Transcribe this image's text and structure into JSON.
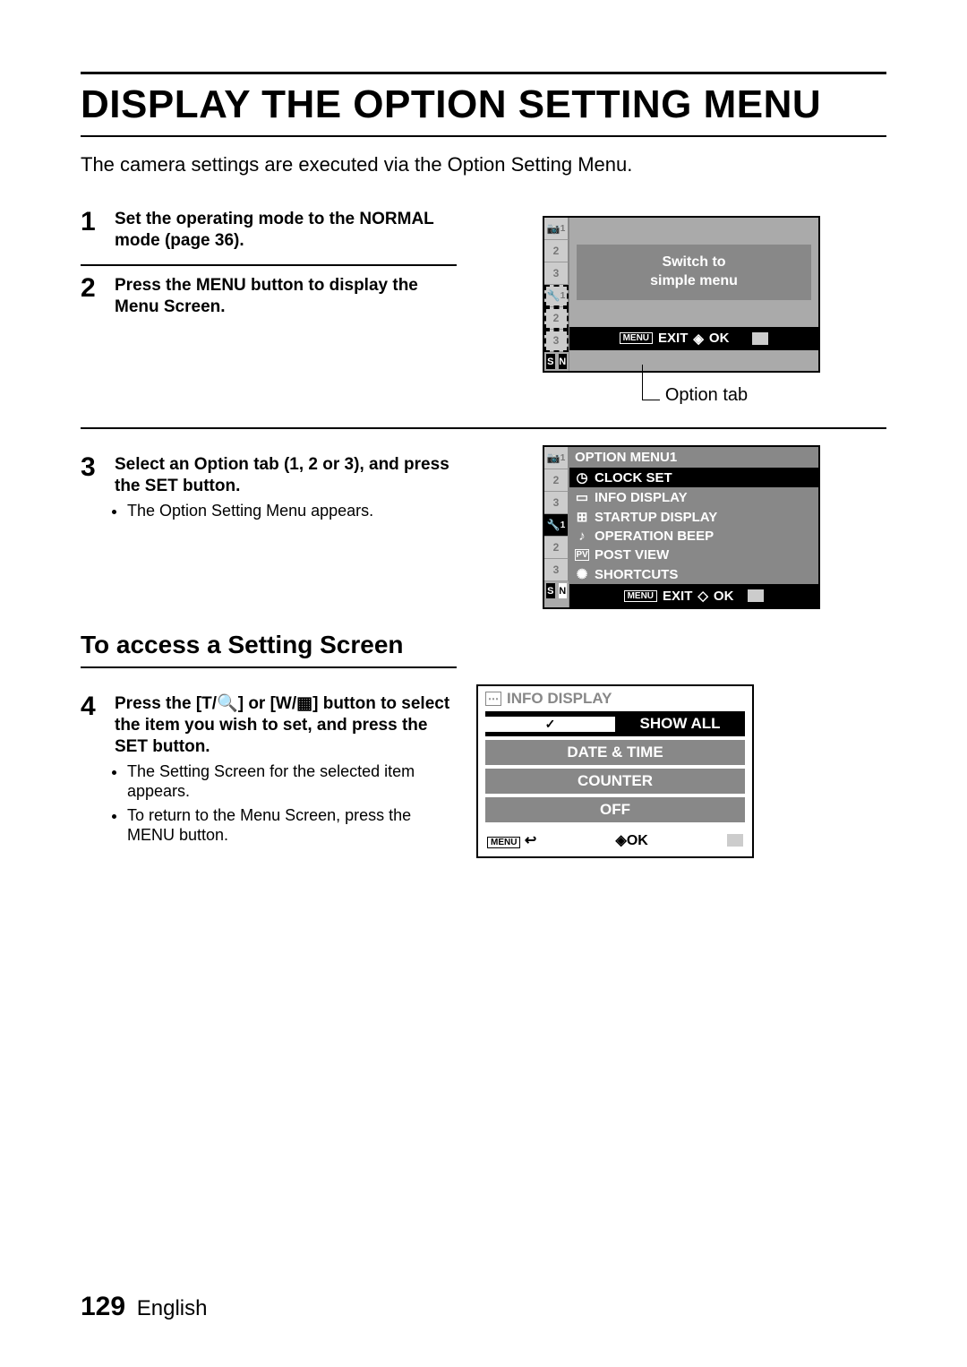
{
  "title": "DISPLAY THE OPTION SETTING MENU",
  "intro": "The camera settings are executed via the Option Setting Menu.",
  "steps": {
    "s1": {
      "num": "1",
      "head": "Set the operating mode to the NORMAL mode (page 36)."
    },
    "s2": {
      "num": "2",
      "head": "Press the MENU button to display the Menu Screen."
    },
    "s3": {
      "num": "3",
      "head": "Select an Option tab (1, 2 or 3), and press the SET button.",
      "bullet1": "The Option Setting Menu appears."
    },
    "s4": {
      "num": "4",
      "head_part1": "Press the [T/",
      "head_part2": "] or [W/",
      "head_part3": "] button to select the item you wish to set, and press the SET button.",
      "bullet1": "The Setting Screen for the selected item appears.",
      "bullet2": "To return to the Menu Screen, press the MENU button."
    }
  },
  "subheading": "To access a Setting Screen",
  "screen1": {
    "msg_line1": "Switch to",
    "msg_line2": "simple menu",
    "menu_tag": "MENU",
    "exit": "EXIT",
    "ok": "OK",
    "tabs": [
      "1",
      "2",
      "3",
      "1",
      "2",
      "3"
    ],
    "label_below": "Option tab"
  },
  "screen2": {
    "title": "OPTION MENU1",
    "items": [
      {
        "icon": "clock-icon",
        "label": "CLOCK SET"
      },
      {
        "icon": "display-icon",
        "label": "INFO DISPLAY"
      },
      {
        "icon": "startup-icon",
        "label": "STARTUP DISPLAY"
      },
      {
        "icon": "beep-icon",
        "label": "OPERATION BEEP"
      },
      {
        "icon": "postview-icon",
        "label": "POST VIEW"
      },
      {
        "icon": "shortcut-icon",
        "label": "SHORTCUTS"
      }
    ],
    "menu_tag": "MENU",
    "exit": "EXIT",
    "ok": "OK",
    "tabs": [
      "1",
      "2",
      "3",
      "1",
      "2",
      "3"
    ]
  },
  "screen3": {
    "header": "INFO DISPLAY",
    "items": [
      "SHOW ALL",
      "DATE & TIME",
      "COUNTER",
      "OFF"
    ],
    "menu_tag": "MENU",
    "ok": "OK"
  },
  "footer": {
    "page": "129",
    "lang": "English"
  }
}
